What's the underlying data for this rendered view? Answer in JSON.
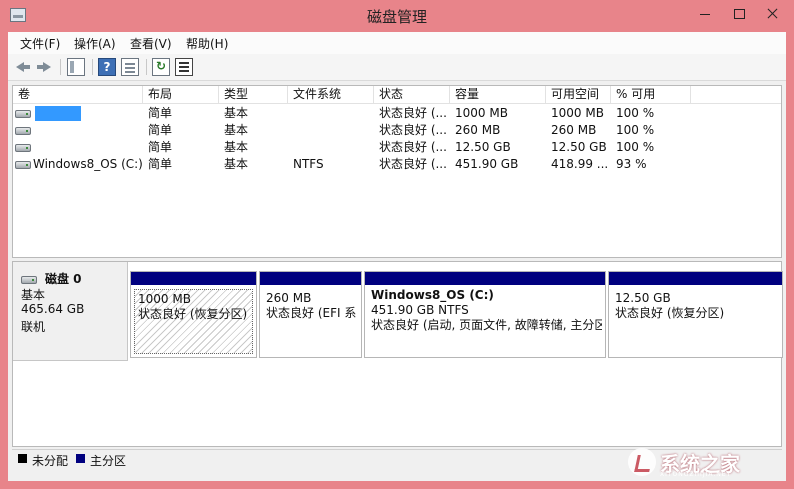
{
  "window": {
    "title": "磁盘管理"
  },
  "menu": [
    "文件(F)",
    "操作(A)",
    "查看(V)",
    "帮助(H)"
  ],
  "toolbar": {
    "icons": [
      "back-icon",
      "forward-icon",
      "console-tree-icon",
      "help-icon",
      "properties-icon",
      "refresh-icon",
      "rescan-disks-icon"
    ]
  },
  "volume_list": {
    "columns": [
      "卷",
      "布局",
      "类型",
      "文件系统",
      "状态",
      "容量",
      "可用空间",
      "% 可用"
    ],
    "rows": [
      {
        "name": "",
        "layout": "简单",
        "type": "基本",
        "fs": "",
        "status": "状态良好 (...",
        "capacity": "1000 MB",
        "free": "1000 MB",
        "pct": "100 %"
      },
      {
        "name": "",
        "layout": "简单",
        "type": "基本",
        "fs": "",
        "status": "状态良好 (...",
        "capacity": "260 MB",
        "free": "260 MB",
        "pct": "100 %"
      },
      {
        "name": "",
        "layout": "简单",
        "type": "基本",
        "fs": "",
        "status": "状态良好 (...",
        "capacity": "12.50 GB",
        "free": "12.50 GB",
        "pct": "100 %"
      },
      {
        "name": "Windows8_OS (C:)",
        "layout": "简单",
        "type": "基本",
        "fs": "NTFS",
        "status": "状态良好 (...",
        "capacity": "451.90 GB",
        "free": "418.99 ...",
        "pct": "93 %"
      }
    ]
  },
  "disk": {
    "name": "磁盘 0",
    "type": "基本",
    "size": "465.64 GB",
    "state": "联机",
    "partitions": [
      {
        "title": "",
        "size": "1000 MB",
        "status": "状态良好 (恢复分区)"
      },
      {
        "title": "",
        "size": "260 MB",
        "status": "状态良好 (EFI 系"
      },
      {
        "title": "Windows8_OS  (C:)",
        "size": "451.90 GB NTFS",
        "status": "状态良好 (启动, 页面文件, 故障转储, 主分区"
      },
      {
        "title": "",
        "size": "12.50 GB",
        "status": "状态良好 (恢复分区)"
      }
    ]
  },
  "legend": {
    "unallocated": "未分配",
    "primary": "主分区",
    "unallocated_color": "#000000",
    "primary_color": "#00007f"
  },
  "watermark": {
    "text": "系统之家",
    "sub": "XITONGZHIJIA.NET"
  }
}
